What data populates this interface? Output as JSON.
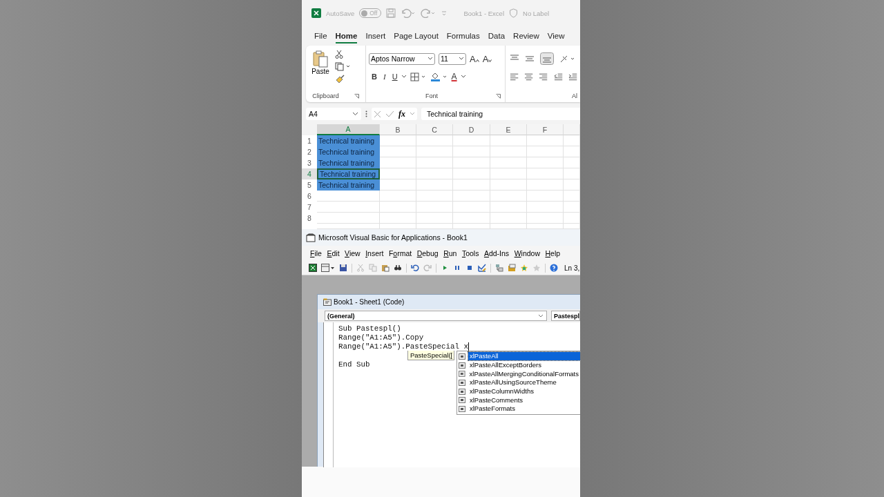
{
  "title_bar": {
    "autosave_label": "AutoSave",
    "autosave_on": false,
    "toggle_text": "Off",
    "title": "Book1  -  Excel",
    "sensitivity": "No Label"
  },
  "ribbon_tabs": [
    {
      "label": "File",
      "selected": false
    },
    {
      "label": "Home",
      "selected": true
    },
    {
      "label": "Insert",
      "selected": false
    },
    {
      "label": "Page Layout",
      "selected": false
    },
    {
      "label": "Formulas",
      "selected": false
    },
    {
      "label": "Data",
      "selected": false
    },
    {
      "label": "Review",
      "selected": false
    },
    {
      "label": "View",
      "selected": false
    }
  ],
  "ribbon": {
    "paste_label": "Paste",
    "font_name": "Aptos Narrow",
    "font_size": "11",
    "grow_font": "A",
    "shrink_font": "A",
    "bold": "B",
    "italic": "I",
    "underline": "U",
    "font_color": "A",
    "groups": [
      "Clipboard",
      "Font",
      "Al"
    ]
  },
  "formula_bar": {
    "name_box": "A4",
    "fx": "fx",
    "value": "Technical training"
  },
  "sheet": {
    "columns": [
      "A",
      "B",
      "C",
      "D",
      "E",
      "F"
    ],
    "rows": [
      {
        "number": "1",
        "value": "Technical training",
        "selected": true,
        "active": false
      },
      {
        "number": "2",
        "value": "Technical training",
        "selected": true,
        "active": false
      },
      {
        "number": "3",
        "value": "Technical training",
        "selected": true,
        "active": false
      },
      {
        "number": "4",
        "value": "Technical training",
        "selected": true,
        "active": true
      },
      {
        "number": "5",
        "value": "Technical training",
        "selected": true,
        "active": false
      },
      {
        "number": "6",
        "selected": false,
        "active": false
      },
      {
        "number": "7",
        "selected": false,
        "active": false
      },
      {
        "number": "8",
        "selected": false,
        "active": false
      }
    ]
  },
  "vba": {
    "title": "Microsoft Visual Basic for Applications - Book1",
    "menu": [
      {
        "key": "F",
        "after": "ile"
      },
      {
        "key": "E",
        "after": "dit"
      },
      {
        "key": "V",
        "after": "iew"
      },
      {
        "key": "I",
        "after": "nsert"
      },
      {
        "before": "F",
        "key": "o",
        "after": "rmat"
      },
      {
        "key": "D",
        "after": "ebug"
      },
      {
        "key": "R",
        "after": "un"
      },
      {
        "key": "T",
        "after": "ools"
      },
      {
        "key": "A",
        "after": "dd-Ins"
      },
      {
        "key": "W",
        "after": "indow"
      },
      {
        "key": "H",
        "after": "elp"
      }
    ],
    "position": "Ln 3,",
    "code_window": {
      "title": "Book1 - Sheet1 (Code)",
      "object": "(General)",
      "procedure": "Pastespl",
      "lines": [
        "Sub Pastespl()",
        "Range(\"A1:A5\").Copy",
        "Range(\"A1:A5\").PasteSpecial x"
      ],
      "end_line": "End Sub",
      "tooltip": "PasteSpecial([",
      "autocomplete": [
        {
          "label": "xlPasteAll",
          "selected": true
        },
        {
          "label": "xlPasteAllExceptBorders",
          "selected": false
        },
        {
          "label": "xlPasteAllMergingConditionalFormats",
          "selected": false
        },
        {
          "label": "xlPasteAllUsingSourceTheme",
          "selected": false
        },
        {
          "label": "xlPasteColumnWidths",
          "selected": false
        },
        {
          "label": "xlPasteComments",
          "selected": false
        },
        {
          "label": "xlPasteFormats",
          "selected": false
        }
      ]
    }
  }
}
